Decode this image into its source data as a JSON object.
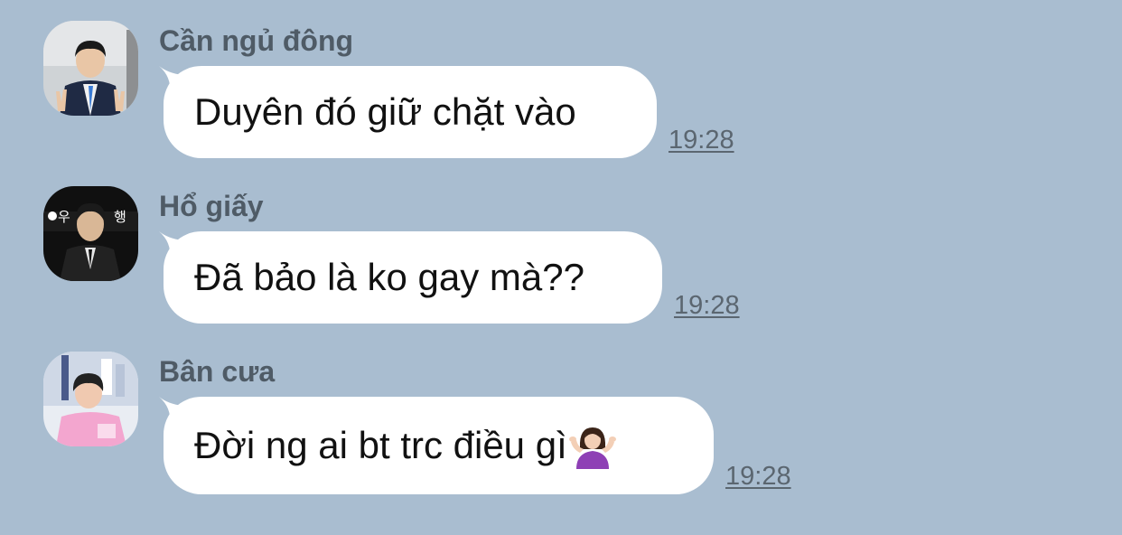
{
  "messages": [
    {
      "sender": "Cần ngủ đông",
      "text": "Duyên đó giữ chặt vào",
      "time": "19:28",
      "avatar": "avatar-man-suit-peace-sign"
    },
    {
      "sender": "Hổ giấy",
      "text": "Đã bảo là ko gay mà??",
      "time": "19:28",
      "avatar": "avatar-man-black-suit"
    },
    {
      "sender": "Bân cưa",
      "text": "Đời ng ai bt trc điều gì",
      "time": "19:28",
      "avatar": "avatar-player-pink-jersey",
      "emoji": "person-shrugging-emoji"
    }
  ],
  "colors": {
    "background": "#a9bdd0",
    "bubble": "#ffffff",
    "sender_name": "#4f5b66",
    "timestamp": "#5b6670"
  }
}
